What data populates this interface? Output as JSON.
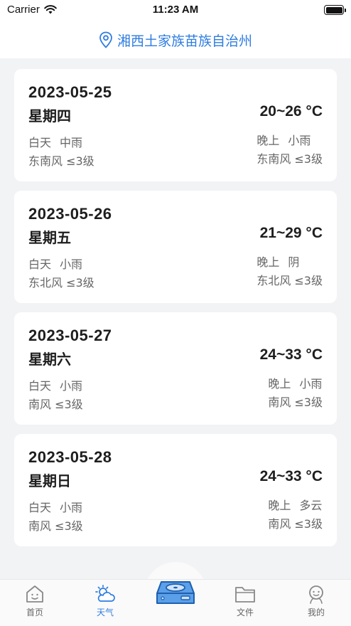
{
  "status_bar": {
    "carrier": "Carrier",
    "time": "11:23 AM"
  },
  "header": {
    "location": "湘西土家族苗族自治州"
  },
  "forecast": [
    {
      "date": "2023-05-25",
      "weekday": "星期四",
      "temp": "20~26 °C",
      "day_label": "白天",
      "day_weather": "中雨",
      "day_wind": "东南风 ≤3级",
      "night_label": "晚上",
      "night_weather": "小雨",
      "night_wind": "东南风 ≤3级"
    },
    {
      "date": "2023-05-26",
      "weekday": "星期五",
      "temp": "21~29 °C",
      "day_label": "白天",
      "day_weather": "小雨",
      "day_wind": "东北风 ≤3级",
      "night_label": "晚上",
      "night_weather": "阴",
      "night_wind": "东北风 ≤3级"
    },
    {
      "date": "2023-05-27",
      "weekday": "星期六",
      "temp": "24~33 °C",
      "day_label": "白天",
      "day_weather": "小雨",
      "day_wind": "南风 ≤3级",
      "night_label": "晚上",
      "night_weather": "小雨",
      "night_wind": "南风 ≤3级"
    },
    {
      "date": "2023-05-28",
      "weekday": "星期日",
      "temp": "24~33 °C",
      "day_label": "白天",
      "day_weather": "小雨",
      "day_wind": "南风 ≤3级",
      "night_label": "晚上",
      "night_weather": "多云",
      "night_wind": "南风 ≤3级"
    }
  ],
  "tabbar": {
    "home": "首页",
    "weather": "天气",
    "files": "文件",
    "mine": "我的"
  },
  "colors": {
    "accent": "#2f7de0",
    "background": "#f2f3f5",
    "card": "#ffffff"
  }
}
